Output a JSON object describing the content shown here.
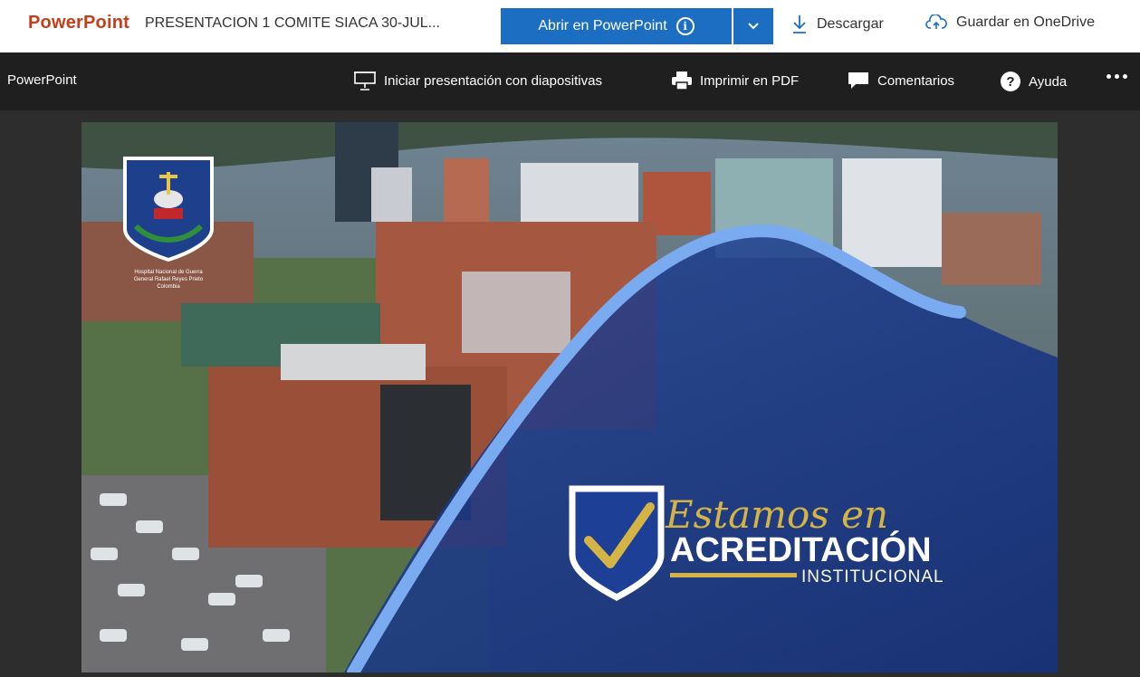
{
  "topbar": {
    "brand": "PowerPoint",
    "filename": "PRESENTACION 1 COMITE SIACA 30-JUL...",
    "open_label": "Abrir en PowerPoint",
    "download_label": "Descargar",
    "onedrive_label": "Guardar en OneDrive"
  },
  "cmdbar": {
    "app_name": "PowerPoint",
    "slideshow_label": "Iniciar presentación con diapositivas",
    "print_label": "Imprimir en PDF",
    "comments_label": "Comentarios",
    "help_label": "Ayuda"
  },
  "slide": {
    "script_text": "Estamos en",
    "headline": "ACREDITACIÓN",
    "subline": "INSTITUCIONAL",
    "emblem_caption_1": "Hospital Nacional de Guerra",
    "emblem_caption_2": "General Rafael Reyes Prieto",
    "emblem_caption_3": "Colombia"
  },
  "colors": {
    "brand": "#c43e1c",
    "primary_button": "#1b6ec2",
    "overlay_blue": "#1a3c8f",
    "curve_light_blue": "#6fa8ec",
    "gold": "#d4b445"
  },
  "icons": [
    "info-icon",
    "chevron-down-icon",
    "download-icon",
    "cloud-upload-icon",
    "presentation-icon",
    "printer-icon",
    "comment-icon",
    "help-icon",
    "more-icon"
  ]
}
